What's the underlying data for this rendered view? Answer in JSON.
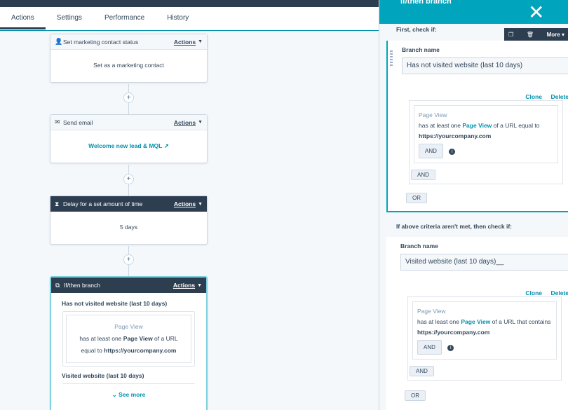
{
  "tabs": [
    "Actions",
    "Settings",
    "Performance",
    "History"
  ],
  "cards": {
    "status": {
      "title": "Set marketing contact status",
      "actions": "Actions",
      "body": "Set as a marketing contact"
    },
    "email": {
      "title": "Send email",
      "actions": "Actions",
      "body": "Welcome new lead & MQL"
    },
    "delay": {
      "title": "Delay for a set amount of time",
      "actions": "Actions",
      "body": "5 days"
    },
    "branch": {
      "title": "If/then branch",
      "actions": "Actions",
      "branch1": "Has not visited website (last 10 days)",
      "pv_title": "Page View",
      "pv_line1a": "has at least one ",
      "pv_line1b": "Page View",
      "pv_line1c": " of a URL",
      "pv_line2a": "equal to ",
      "pv_line2b": "https://yourcompany.com",
      "branch2": "Visited website (last 10 days)",
      "see_more": "See more"
    }
  },
  "panel": {
    "title": "If/then branch",
    "first_check": "First, check if:",
    "toolbar_more": "More",
    "branch_name_label": "Branch name",
    "branch1_value": "Has not visited website (last 10 days)",
    "clone": "Clone",
    "delete": "Delete",
    "pv_title": "Page View",
    "f1_pre": "has at least one ",
    "f1_link": "Page View",
    "f1_post": " of a URL equal to",
    "url": "https://yourcompany.com",
    "and": "AND",
    "or": "OR",
    "else_check": "If above criteria aren't met, then check if:",
    "branch2_value": "Visited website (last 10 days)__",
    "f2_pre": "has at least one ",
    "f2_link": "Page View",
    "f2_post": " of a URL that contains"
  },
  "plus": "+"
}
